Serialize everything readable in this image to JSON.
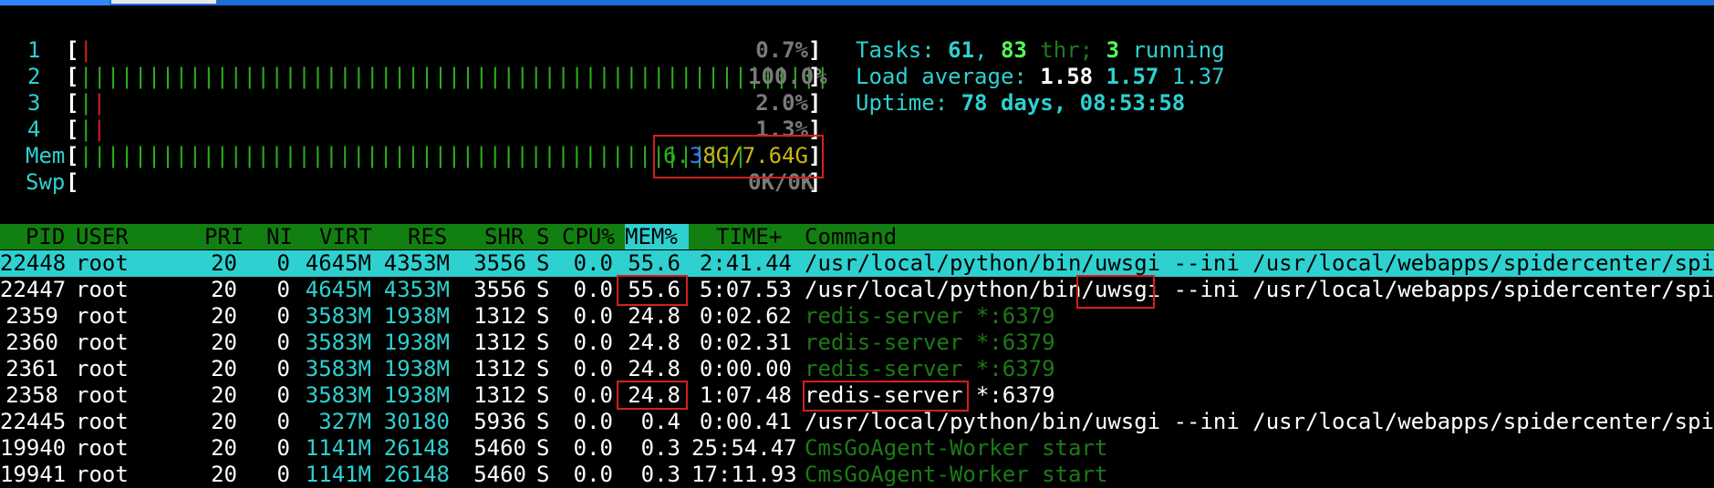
{
  "meters": {
    "cpu": [
      {
        "label": "1",
        "bar": "|",
        "bar_colors": [
          "r"
        ],
        "percent": "0.7%"
      },
      {
        "label": "2",
        "bar": "|||||||||||||||||||||||||||||||||||||||||||||||||||||||",
        "percent": "100.0%"
      },
      {
        "label": "3",
        "bar": "||",
        "percent": "2.0%"
      },
      {
        "label": "4",
        "bar": "||",
        "percent": "1.3%"
      }
    ],
    "mem": {
      "label": "Mem",
      "bar": "|||||||||||||||||||||||||||||||||||||||||||||||||",
      "used_a": "6.",
      "used_b": "3",
      "used_c": "8G/7.64G"
    },
    "swp": {
      "label": "Swp",
      "value": "0K/0K"
    }
  },
  "stats": {
    "tasks_label": "Tasks: ",
    "tasks": "61",
    "sep1": ", ",
    "threads": "83",
    "thr_label": " thr; ",
    "running": "3",
    "running_label": " running",
    "load_label": "Load average: ",
    "load1": "1.58",
    "load5": "1.57",
    "load15": "1.37",
    "uptime_label": "Uptime: ",
    "uptime": "78 days, 08:53:58"
  },
  "header": {
    "pid": "PID",
    "user": "USER",
    "pri": "PRI",
    "ni": "NI",
    "virt": "VIRT",
    "res": "RES",
    "shr": "SHR",
    "s": "S",
    "cpu": "CPU%",
    "mem": "MEM%",
    "time": "TIME+",
    "command": "Command"
  },
  "processes": [
    {
      "pid": "22448",
      "user": "root",
      "pri": "20",
      "ni": "0",
      "virt": "4645M",
      "res": "4353M",
      "shr": "3556",
      "s": "S",
      "cpu": "0.0",
      "mem": "55.6",
      "time": "2:41.44",
      "command": "/usr/local/python/bin/uwsgi --ini /usr/local/webapps/spidercenter/spide",
      "kind": "user"
    },
    {
      "pid": "22447",
      "user": "root",
      "pri": "20",
      "ni": "0",
      "virt": "4645M",
      "res": "4353M",
      "shr": "3556",
      "s": "S",
      "cpu": "0.0",
      "mem": "55.6",
      "time": "5:07.53",
      "command": "/usr/local/python/bin/uwsgi --ini /usr/local/webapps/spidercenter/spide",
      "kind": "user"
    },
    {
      "pid": "2359",
      "user": "root",
      "pri": "20",
      "ni": "0",
      "virt": "3583M",
      "res": "1938M",
      "shr": "1312",
      "s": "S",
      "cpu": "0.0",
      "mem": "24.8",
      "time": "0:02.62",
      "command": "redis-server *:6379",
      "kind": "thread"
    },
    {
      "pid": "2360",
      "user": "root",
      "pri": "20",
      "ni": "0",
      "virt": "3583M",
      "res": "1938M",
      "shr": "1312",
      "s": "S",
      "cpu": "0.0",
      "mem": "24.8",
      "time": "0:02.31",
      "command": "redis-server *:6379",
      "kind": "thread"
    },
    {
      "pid": "2361",
      "user": "root",
      "pri": "20",
      "ni": "0",
      "virt": "3583M",
      "res": "1938M",
      "shr": "1312",
      "s": "S",
      "cpu": "0.0",
      "mem": "24.8",
      "time": "0:00.00",
      "command": "redis-server *:6379",
      "kind": "thread"
    },
    {
      "pid": "2358",
      "user": "root",
      "pri": "20",
      "ni": "0",
      "virt": "3583M",
      "res": "1938M",
      "shr": "1312",
      "s": "S",
      "cpu": "0.0",
      "mem": "24.8",
      "time": "1:07.48",
      "command": "redis-server *:6379",
      "kind": "user"
    },
    {
      "pid": "22445",
      "user": "root",
      "pri": "20",
      "ni": "0",
      "virt": "327M",
      "res": "30180",
      "shr": "5936",
      "s": "S",
      "cpu": "0.0",
      "mem": "0.4",
      "time": "0:00.41",
      "command": "/usr/local/python/bin/uwsgi --ini /usr/local/webapps/spidercenter/spide",
      "kind": "user"
    },
    {
      "pid": "19940",
      "user": "root",
      "pri": "20",
      "ni": "0",
      "virt": "1141M",
      "res": "26148",
      "shr": "5460",
      "s": "S",
      "cpu": "0.0",
      "mem": "0.3",
      "time": "25:54.47",
      "command": "CmsGoAgent-Worker start",
      "kind": "thread"
    },
    {
      "pid": "19941",
      "user": "root",
      "pri": "20",
      "ni": "0",
      "virt": "1141M",
      "res": "26148",
      "shr": "5460",
      "s": "S",
      "cpu": "0.0",
      "mem": "0.3",
      "time": "17:11.93",
      "command": "CmsGoAgent-Worker start",
      "kind": "thread"
    }
  ],
  "colors": {
    "accent_cyan": "#2fd0d0",
    "header_green": "#128010",
    "highlight_red": "#d32020"
  }
}
